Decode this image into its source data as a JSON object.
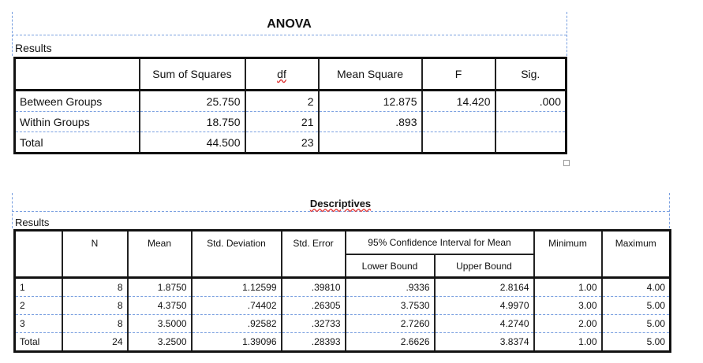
{
  "anova": {
    "title": "ANOVA",
    "subtitle": "Results",
    "columns": [
      "",
      "Sum of Squares",
      "df",
      "Mean Square",
      "F",
      "Sig."
    ],
    "rows": [
      [
        "Between Groups",
        "25.750",
        "2",
        "12.875",
        "14.420",
        ".000"
      ],
      [
        "Within Groups",
        "18.750",
        "21",
        ".893",
        "",
        ""
      ],
      [
        "Total",
        "44.500",
        "23",
        "",
        "",
        ""
      ]
    ]
  },
  "descriptives": {
    "title": "Descriptives",
    "subtitle": "Results",
    "columns": [
      "",
      "N",
      "Mean",
      "Std. Deviation",
      "Std. Error",
      "95% Confidence Interval for Mean",
      "Minimum",
      "Maximum"
    ],
    "subcolumns": [
      "Lower Bound",
      "Upper Bound"
    ],
    "rows": [
      [
        "1",
        "8",
        "1.8750",
        "1.12599",
        ".39810",
        ".9336",
        "2.8164",
        "1.00",
        "4.00"
      ],
      [
        "2",
        "8",
        "4.3750",
        ".74402",
        ".26305",
        "3.7530",
        "4.9970",
        "3.00",
        "5.00"
      ],
      [
        "3",
        "8",
        "3.5000",
        ".92582",
        ".32733",
        "2.7260",
        "4.2740",
        "2.00",
        "5.00"
      ],
      [
        "Total",
        "24",
        "3.2500",
        "1.39096",
        ".28393",
        "2.6626",
        "3.8374",
        "1.00",
        "5.00"
      ]
    ]
  }
}
